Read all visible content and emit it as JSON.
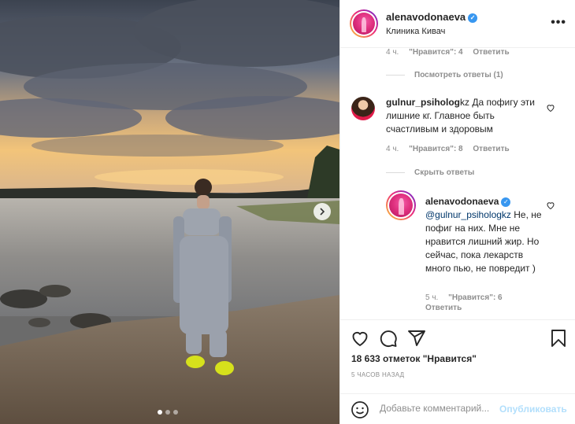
{
  "post": {
    "author": "alenavodonaeva",
    "location": "Клиника Кивач",
    "more_label": "•••"
  },
  "comments": {
    "first_meta": {
      "time": "4 ч.",
      "likes": "\"Нравится\": 4",
      "reply": "Ответить"
    },
    "first_view_replies": "Посмотреть ответы (1)",
    "second": {
      "username": "gulnur_psiholog",
      "text": "Да пофигу эти лишние кг. Главное быть счастливым и здоровым",
      "time": "4 ч.",
      "likes": "\"Нравится\": 8",
      "reply": "Ответить",
      "hide_replies": "Скрыть ответы"
    },
    "reply": {
      "username": "alenavodonaeva",
      "mention": "@gulnur_psihologkz",
      "text": "Не, не пофиг на них. Мне не нравится лишний жир. Но сейчас, пока лекарств много пью, не повредит )",
      "time": "5 ч.",
      "likes": "\"Нравится\": 6",
      "reply": "Ответить"
    }
  },
  "actions": {
    "likes_count": "18 633 отметок \"Нравится\"",
    "time_ago": "5 ЧАСОВ НАЗАД",
    "comment_placeholder": "Добавьте комментарий...",
    "publish_label": "Опубликовать"
  },
  "carousel": {
    "current": 1,
    "total": 3
  },
  "colors": {
    "accent": "#3897f0",
    "link": "#00376b",
    "muted": "#8e8e8e",
    "publish_disabled": "#b2dffc"
  },
  "icons": [
    "chevron-right-icon",
    "verified-icon",
    "heart-icon",
    "comment-icon",
    "share-icon",
    "bookmark-icon",
    "emoji-icon",
    "more-icon"
  ]
}
